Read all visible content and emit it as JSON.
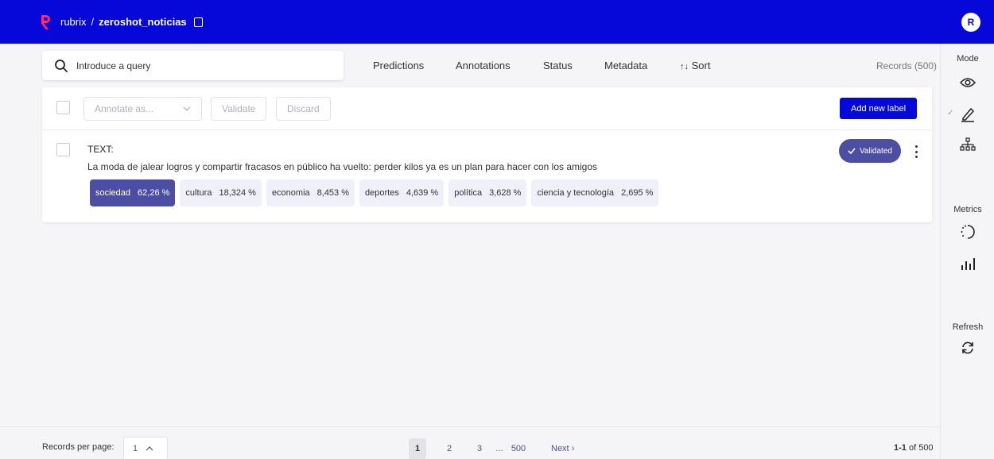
{
  "header": {
    "app_name": "rubrix",
    "separator": "/",
    "dataset_name": "zeroshot_noticias",
    "user_initial": "R",
    "brand_color": "#0508d9"
  },
  "search": {
    "placeholder": "Introduce a query"
  },
  "filters": {
    "predictions": "Predictions",
    "annotations": "Annotations",
    "status": "Status",
    "metadata": "Metadata",
    "sort": "Sort"
  },
  "records_count": "Records (500)",
  "toolbar": {
    "annotate_as": "Annotate as...",
    "validate": "Validate",
    "discard": "Discard",
    "add_new_label": "Add new label"
  },
  "record": {
    "field_label": "TEXT:",
    "text": "La moda de jalear logros y compartir fracasos en público ha vuelto: perder kilos ya es un plan para hacer con los amigos",
    "status": "Validated",
    "labels": [
      {
        "name": "sociedad",
        "score": "62,26 %",
        "selected": true
      },
      {
        "name": "cultura",
        "score": "18,324 %",
        "selected": false
      },
      {
        "name": "economia",
        "score": "8,453 %",
        "selected": false
      },
      {
        "name": "deportes",
        "score": "4,639 %",
        "selected": false
      },
      {
        "name": "política",
        "score": "3,628 %",
        "selected": false
      },
      {
        "name": "ciencia y tecnología",
        "score": "2,695 %",
        "selected": false
      }
    ]
  },
  "sidebar": {
    "mode_title": "Mode",
    "metrics_title": "Metrics",
    "refresh_title": "Refresh",
    "mode_icons": [
      "eye-icon",
      "pencil-icon",
      "hierarchy-icon"
    ],
    "metrics_icons": [
      "progress-icon",
      "bar-chart-icon"
    ],
    "refresh_icon": "refresh-icon"
  },
  "footer": {
    "records_per_page_label": "Records per page:",
    "records_per_page_value": "1",
    "pages": [
      "1",
      "2",
      "3"
    ],
    "ellipsis": "...",
    "last_page": "500",
    "next": "Next",
    "range_bold": "1-1",
    "range_rest": "of 500"
  }
}
